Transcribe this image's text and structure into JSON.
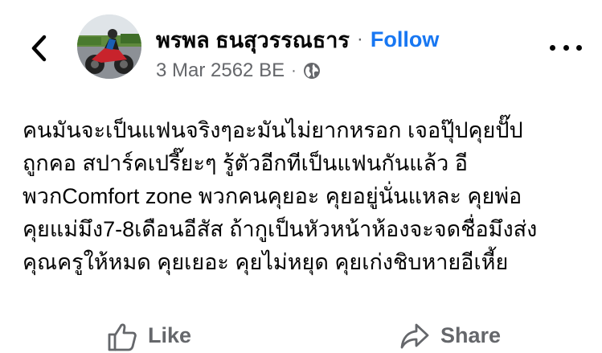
{
  "header": {
    "back_icon": "chevron-left-icon",
    "author_name": "พรพล ธนสุวรรณธาร",
    "separator": "·",
    "follow_label": "Follow",
    "date": "3 Mar 2562 BE",
    "meta_separator": "·",
    "privacy_icon": "globe-icon",
    "more_icon": "more-options-icon"
  },
  "post": {
    "lines": [
      "คนมันจะเป็นแฟนจริงๆอะมันไม่ยากหรอก เจอปุ๊ปคุยปั๊ป",
      "ถูกคอ สปาร์คเปรี๊ยะๆ รู้ตัวอีกทีเป็นแฟนกันแล้ว อี",
      "พวกComfort zone พวกคนคุยอะ คุยอยู่นั่นแหละ คุยพ่อ",
      "คุยแม่มึง7-8เดือนอีสัส ถ้ากูเป็นหัวหน้าห้องจะจดชื่อมึงส่ง",
      "คุณครูให้หมด คุยเยอะ คุยไม่หยุด คุยเก่งชิบหายอีเหี้ย"
    ]
  },
  "actions": {
    "like_label": "Like",
    "like_icon": "thumbs-up-icon",
    "share_label": "Share",
    "share_icon": "share-arrow-icon"
  },
  "colors": {
    "accent": "#1877f2",
    "secondary_text": "#65676b",
    "primary_text": "#050505"
  }
}
